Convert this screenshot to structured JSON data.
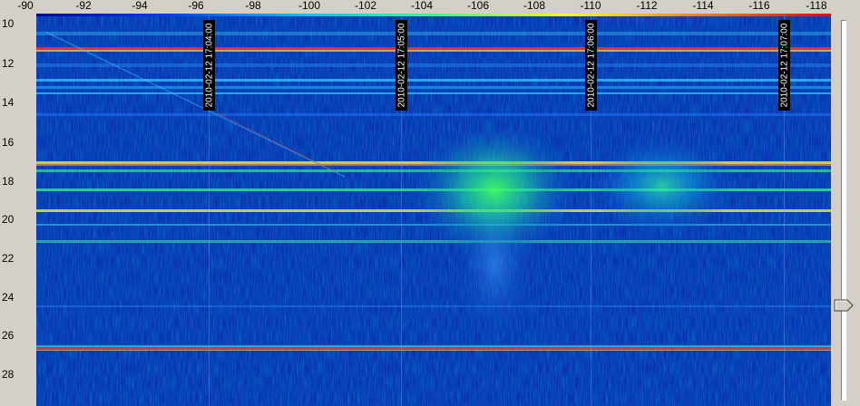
{
  "x_axis": {
    "ticks": [
      "-90",
      "-92",
      "-94",
      "-96",
      "-98",
      "-100",
      "-102",
      "-104",
      "-106",
      "-108",
      "-110",
      "-112",
      "-114",
      "-116",
      "-118"
    ]
  },
  "y_axis": {
    "ticks": [
      "10",
      "12",
      "14",
      "16",
      "18",
      "20",
      "22",
      "24",
      "26",
      "28"
    ]
  },
  "timestamps": [
    "2010-02-12 17:04:00",
    "2010-02-12 17:05:00",
    "2010-02-12 17:06:00",
    "2010-02-12 17:07:00"
  ],
  "colors": {
    "background": "#0a1a9e",
    "window": "#d4d0c8"
  },
  "scrollbar": {
    "thumb_icon": "slider-pentagon-icon"
  }
}
